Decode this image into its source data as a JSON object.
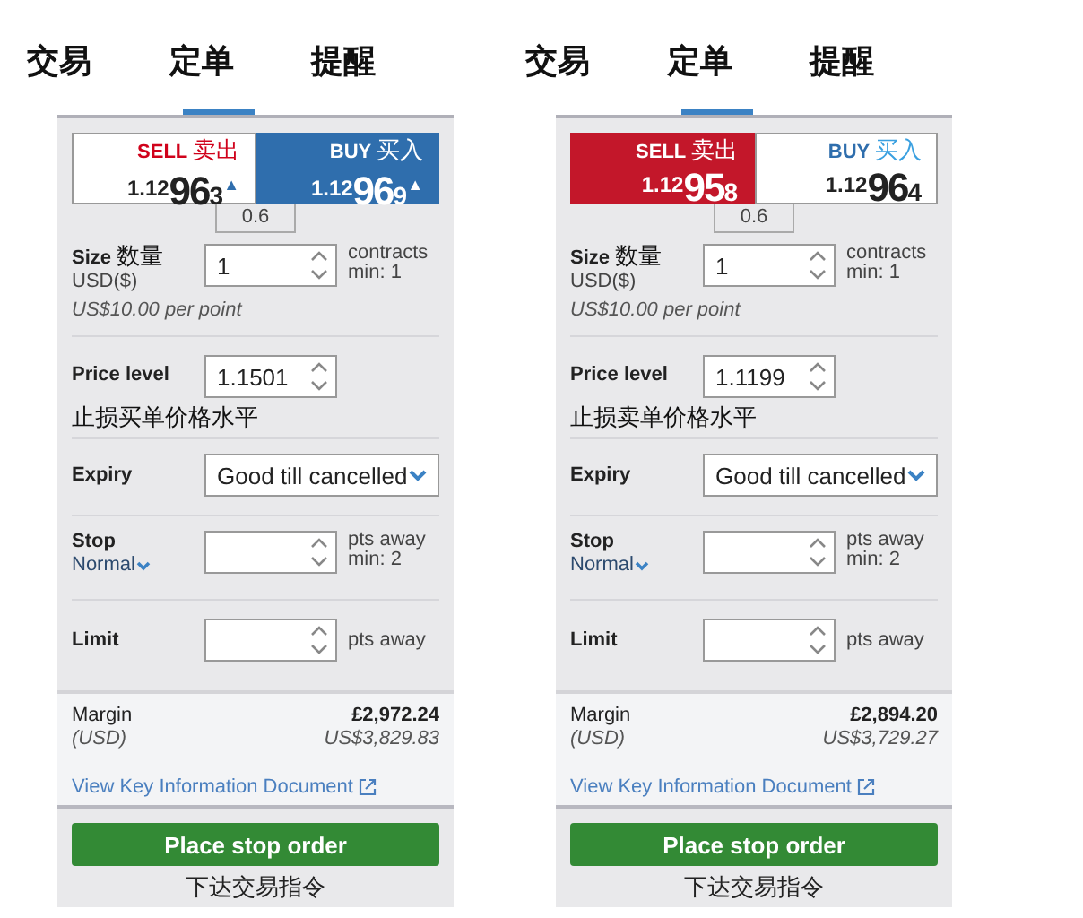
{
  "panels": [
    {
      "tabs": [
        {
          "label": "交易",
          "selected": false
        },
        {
          "label": "定单",
          "selected": true
        },
        {
          "label": "提醒",
          "selected": false
        }
      ],
      "quotes": [
        {
          "kind": "sell",
          "label": "SELL",
          "label_cn": "卖出",
          "price_prefix": "1.12",
          "price_main": "96",
          "price_suffix": "3",
          "tick": "▲",
          "selected": false
        },
        {
          "kind": "buy",
          "label": "BUY",
          "label_cn": "买入",
          "price_prefix": "1.12",
          "price_main": "96",
          "price_suffix": "9",
          "tick": "▲",
          "selected": true
        }
      ],
      "spread": "0.6",
      "size": {
        "label": "Size",
        "annotation": "数量",
        "unit": "USD($)",
        "per_point": "US$10.00 per point",
        "value": "1",
        "note": "contracts",
        "min": "min: 1"
      },
      "price_level": {
        "label": "Price level",
        "value": "1.1501",
        "annotation": "止损买单价格水平"
      },
      "expiry": {
        "label": "Expiry",
        "value": "Good till cancelled"
      },
      "stop": {
        "label": "Stop",
        "type": "Normal",
        "note": "pts away",
        "min": "min: 2"
      },
      "limit": {
        "label": "Limit",
        "note": "pts away"
      },
      "margin": {
        "label": "Margin",
        "currency": "(USD)",
        "value": "£2,972.24",
        "value_usd": "US$3,829.83"
      },
      "link": "View Key Information Document",
      "button": "Place stop order",
      "button_annotation": "下达交易指令"
    },
    {
      "tabs": [
        {
          "label": "交易",
          "selected": false
        },
        {
          "label": "定单",
          "selected": true
        },
        {
          "label": "提醒",
          "selected": false
        }
      ],
      "quotes": [
        {
          "kind": "sell",
          "label": "SELL",
          "label_cn": "卖出",
          "price_prefix": "1.12",
          "price_main": "95",
          "price_suffix": "8",
          "selected": true
        },
        {
          "kind": "buy",
          "label": "BUY",
          "label_cn": "买入",
          "price_prefix": "1.12",
          "price_main": "96",
          "price_suffix": "4",
          "selected": false
        }
      ],
      "spread": "0.6",
      "size": {
        "label": "Size",
        "annotation": "数量",
        "unit": "USD($)",
        "per_point": "US$10.00 per point",
        "value": "1",
        "note": "contracts",
        "min": "min: 1"
      },
      "price_level": {
        "label": "Price level",
        "value": "1.1199",
        "annotation": "止损卖单价格水平"
      },
      "expiry": {
        "label": "Expiry",
        "value": "Good till cancelled"
      },
      "stop": {
        "label": "Stop",
        "type": "Normal",
        "note": "pts away",
        "min": "min: 2"
      },
      "limit": {
        "label": "Limit",
        "note": "pts away"
      },
      "margin": {
        "label": "Margin",
        "currency": "(USD)",
        "value": "£2,894.20",
        "value_usd": "US$3,729.27"
      },
      "link": "View Key Information Document",
      "button": "Place stop order",
      "button_annotation": "下达交易指令"
    }
  ]
}
